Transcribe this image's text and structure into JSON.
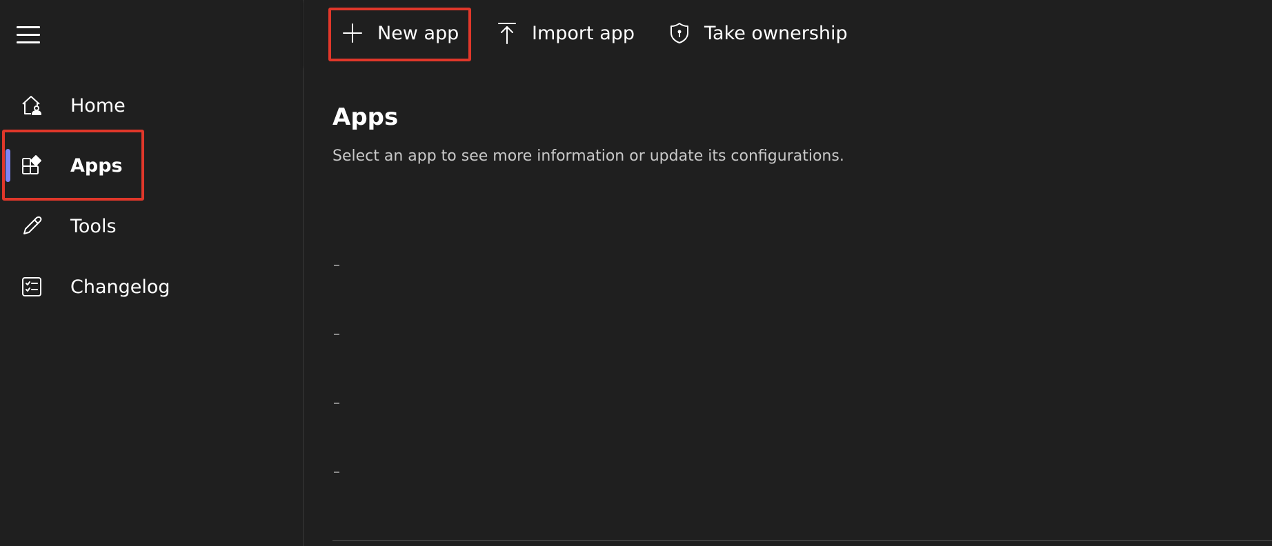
{
  "sidebar": {
    "menu_icon": "hamburger-icon",
    "items": [
      {
        "label": "Home",
        "icon": "home-person-icon",
        "active": false
      },
      {
        "label": "Apps",
        "icon": "apps-icon",
        "active": true
      },
      {
        "label": "Tools",
        "icon": "pencil-icon",
        "active": false
      },
      {
        "label": "Changelog",
        "icon": "checklist-icon",
        "active": false
      }
    ],
    "active_indicator_color": "#7f85f5"
  },
  "commandbar": {
    "new_app_label": "New app",
    "import_app_label": "Import app",
    "take_ownership_label": "Take ownership"
  },
  "main": {
    "title": "Apps",
    "subtitle": "Select an app to see more information or update its configurations."
  },
  "highlight_color": "#e0372a"
}
